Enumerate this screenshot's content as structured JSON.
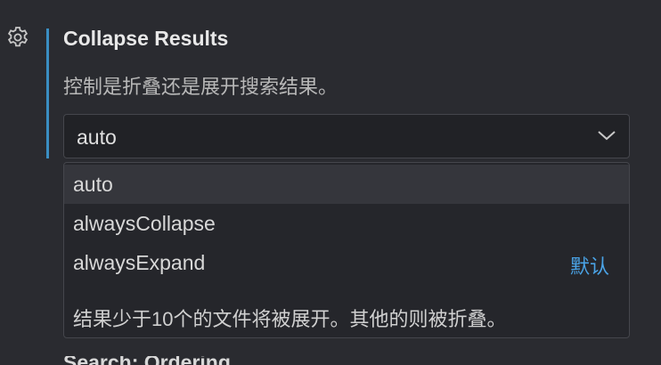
{
  "setting": {
    "title": "Collapse Results",
    "description": "控制是折叠还是展开搜索结果。",
    "selected_value": "auto",
    "gear_icon": "gear-icon",
    "chevron_icon": "chevron-down-icon",
    "accent_color": "#3a8ec2"
  },
  "dropdown": {
    "options": [
      {
        "label": "auto",
        "default_tag": ""
      },
      {
        "label": "alwaysCollapse",
        "default_tag": ""
      },
      {
        "label": "alwaysExpand",
        "default_tag": "默认"
      }
    ],
    "highlighted_index": 0,
    "option_description": "结果少于10个的文件将被展开。其他的则被折叠。",
    "default_tag_color": "#4aa3e6"
  },
  "next_setting": {
    "title_fragment": "Search: Ordering"
  }
}
